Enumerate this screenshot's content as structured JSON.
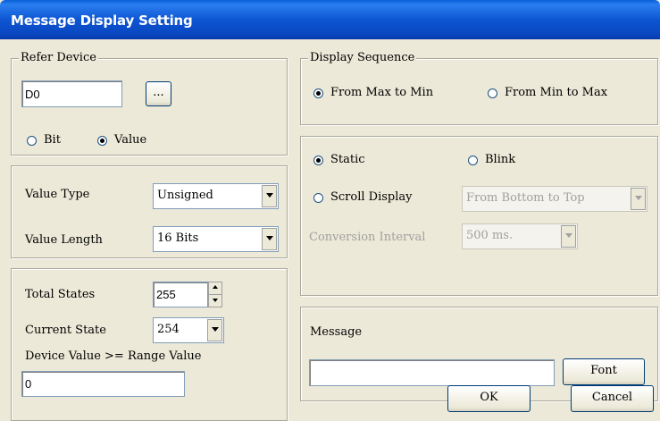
{
  "window": {
    "title": "Message Display Setting"
  },
  "refer_device": {
    "legend": "Refer Device",
    "device_value": "D0",
    "browse_label": "...",
    "bit_label": "Bit",
    "value_label": "Value"
  },
  "value_settings": {
    "type_label": "Value Type",
    "type_value": "Unsigned",
    "length_label": "Value Length",
    "length_value": "16 Bits"
  },
  "states": {
    "total_label": "Total States",
    "total_value": "255",
    "current_label": "Current State",
    "current_value": "254",
    "range_label": "Device Value >= Range Value",
    "range_value": "0"
  },
  "display_sequence": {
    "legend": "Display Sequence",
    "max_to_min_label": "From Max to Min",
    "min_to_max_label": "From Min to Max"
  },
  "display_mode": {
    "static_label": "Static",
    "blink_label": "Blink",
    "scroll_label": "Scroll Display",
    "scroll_direction_value": "From Bottom to Top",
    "interval_label": "Conversion Interval",
    "interval_value": "500  ms."
  },
  "message": {
    "label": "Message",
    "value": "",
    "font_button": "Font"
  },
  "footer": {
    "ok_label": "OK",
    "cancel_label": "Cancel"
  },
  "colors": {
    "title_bar": "#0a46c0",
    "dialog_bg": "#ece9d8",
    "title_text": "#ffffff"
  }
}
